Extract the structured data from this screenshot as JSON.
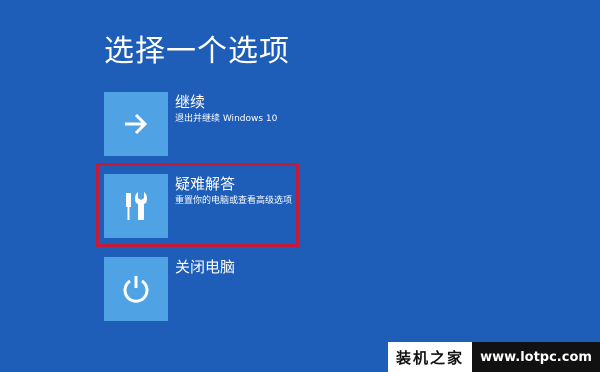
{
  "page": {
    "title": "选择一个选项"
  },
  "options": [
    {
      "icon": "arrow-right-icon",
      "title": "继续",
      "description": "退出并继续 Windows 10"
    },
    {
      "icon": "tools-icon",
      "title": "疑难解答",
      "description": "重置你的电脑或查看高级选项"
    },
    {
      "icon": "power-icon",
      "title": "关闭电脑",
      "description": ""
    }
  ],
  "colors": {
    "background": "#1e5db8",
    "tile": "#4fa3e4",
    "highlight_border": "#c51b3a"
  },
  "watermark": {
    "brand": "装机之家",
    "url": "www.lotpc.com"
  }
}
